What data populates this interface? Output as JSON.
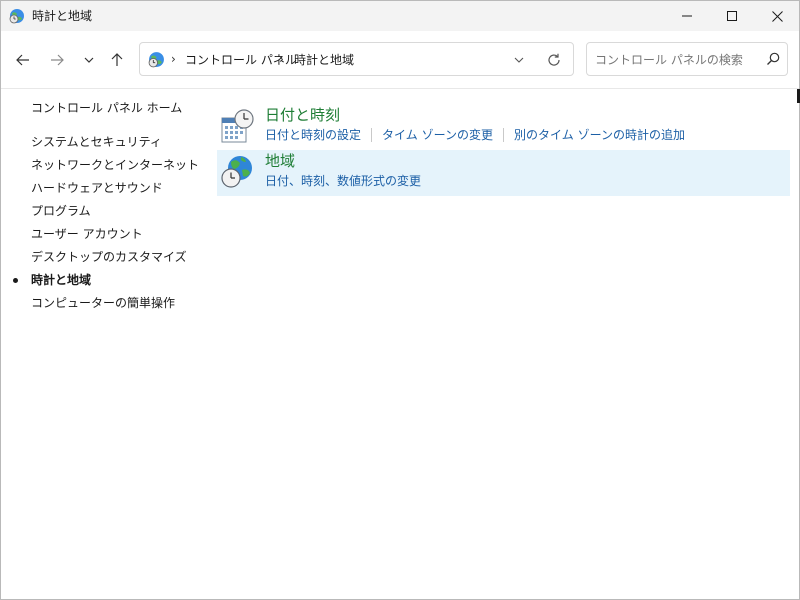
{
  "window": {
    "title": "時計と地域"
  },
  "nav": {
    "back_icon": "arrow-left-icon",
    "forward_icon": "arrow-right-icon",
    "recent_icon": "chevron-down-icon",
    "up_icon": "arrow-up-icon"
  },
  "address": {
    "segments": [
      "コントロール パネル",
      "時計と地域"
    ],
    "separator": "›"
  },
  "search": {
    "placeholder": "コントロール パネルの検索"
  },
  "sidebar": {
    "home": "コントロール パネル ホーム",
    "items": [
      {
        "label": "システムとセキュリティ",
        "current": false
      },
      {
        "label": "ネットワークとインターネット",
        "current": false
      },
      {
        "label": "ハードウェアとサウンド",
        "current": false
      },
      {
        "label": "プログラム",
        "current": false
      },
      {
        "label": "ユーザー アカウント",
        "current": false
      },
      {
        "label": "デスクトップのカスタマイズ",
        "current": false
      },
      {
        "label": "時計と地域",
        "current": true
      },
      {
        "label": "コンピューターの簡単操作",
        "current": false
      }
    ]
  },
  "main": {
    "categories": [
      {
        "title": "日付と時刻",
        "icon": "calendar-clock-icon",
        "links": [
          "日付と時刻の設定",
          "タイム ゾーンの変更",
          "別のタイム ゾーンの時計の追加"
        ]
      },
      {
        "title": "地域",
        "icon": "globe-clock-icon",
        "links": [
          "日付、時刻、数値形式の変更"
        ]
      }
    ]
  },
  "colors": {
    "category_title": "#1e7d35",
    "link": "#1c5fa6",
    "hover_bg": "#e5f3fb",
    "titlebar_bg": "#f3f3f3"
  }
}
